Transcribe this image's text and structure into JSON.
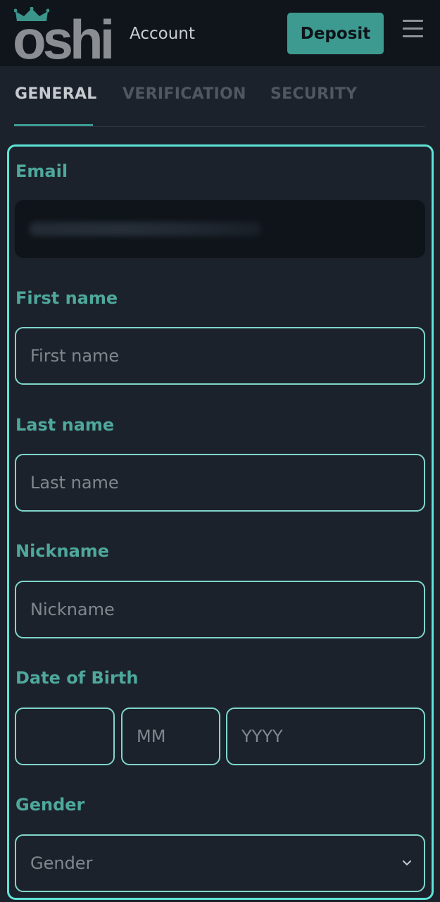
{
  "header": {
    "logo_text": "oshi",
    "page_label": "Account",
    "deposit_label": "Deposit",
    "menu_icon": "hamburger-icon"
  },
  "tabs": [
    {
      "label": "GENERAL",
      "active": true
    },
    {
      "label": "VERIFICATION",
      "active": false
    },
    {
      "label": "SECURITY",
      "active": false
    }
  ],
  "form": {
    "email_label": "Email",
    "first_name_label": "First name",
    "first_name_placeholder": "First name",
    "last_name_label": "Last name",
    "last_name_placeholder": "Last name",
    "nickname_label": "Nickname",
    "nickname_placeholder": "Nickname",
    "dob_label": "Date of Birth",
    "dob_day_placeholder": "",
    "dob_month_placeholder": "MM",
    "dob_year_placeholder": "YYYY",
    "gender_label": "Gender",
    "gender_placeholder": "Gender"
  },
  "colors": {
    "accent": "#3d9a90",
    "label_teal": "#4ea89c",
    "card_border": "#5fe3d8",
    "background": "#1c222b"
  }
}
